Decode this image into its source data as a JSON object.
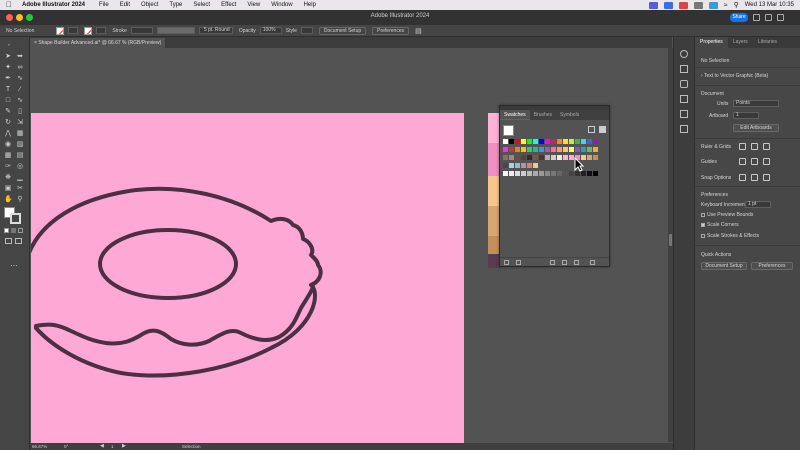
{
  "menubar": {
    "app_name": "Adobe Illustrator 2024",
    "items": [
      "File",
      "Edit",
      "Object",
      "Type",
      "Select",
      "Effect",
      "View",
      "Window",
      "Help"
    ],
    "clock": "Wed 13 Mar  10:35"
  },
  "window": {
    "title": "Adobe Illustrator 2024",
    "share_label": "Share"
  },
  "controlbar": {
    "selection": "No Selection",
    "stroke_label": "Stroke",
    "brush": "5 pt. Round",
    "opacity_label": "Opacity",
    "opacity_value": "100%",
    "style_label": "Style",
    "document_setup": "Document Setup",
    "preferences": "Preferences"
  },
  "document_tab": "Shape Builder Advanced.ai* @ 66.67 % (RGB/Preview)",
  "swatches_panel": {
    "tabs": [
      "Swatches",
      "Brushes",
      "Symbols"
    ],
    "active_tab": "Swatches"
  },
  "right_panel": {
    "tabs": [
      "Properties",
      "Layers",
      "Libraries"
    ],
    "active_tab": "Properties",
    "no_selection": "No Selection",
    "text_to_vector": "Text to Vector Graphic (Beta)",
    "document_heading": "Document",
    "units_label": "Units",
    "units_value": "Points",
    "artboard_label": "Artboard",
    "artboard_value": "1",
    "edit_artboards": "Edit Artboards",
    "ruler_grids": "Ruler & Grids",
    "guides": "Guides",
    "snap_options": "Snap Options",
    "preferences_heading": "Preferences",
    "keyboard_increment_label": "Keyboard Increment",
    "keyboard_increment_value": "1 pt",
    "use_preview_bounds": "Use Preview Bounds",
    "scale_corners": "Scale Corners",
    "scale_strokes": "Scale Strokes & Effects",
    "quick_actions": "Quick Actions",
    "document_setup_btn": "Document Setup",
    "preferences_btn": "Preferences",
    "use_preview_bounds_checked": false,
    "scale_corners_checked": true,
    "scale_strokes_checked": false
  },
  "statusbar": {
    "zoom": "66.67%",
    "rotation": "0°",
    "artboard": "1",
    "tool": "Selection"
  },
  "colors": {
    "artboard": "#fea8d6",
    "stroke": "#4a3042",
    "strip": [
      "#ffb2d6",
      "#ef8ec0",
      "#f6c68c",
      "#d9a673",
      "#c1905b",
      "#5a3b4f"
    ]
  },
  "icons": [
    "apple-icon",
    "selection-tool-icon",
    "direct-selection-tool-icon",
    "pen-tool-icon",
    "type-tool-icon",
    "cursor-arrow-icon"
  ]
}
